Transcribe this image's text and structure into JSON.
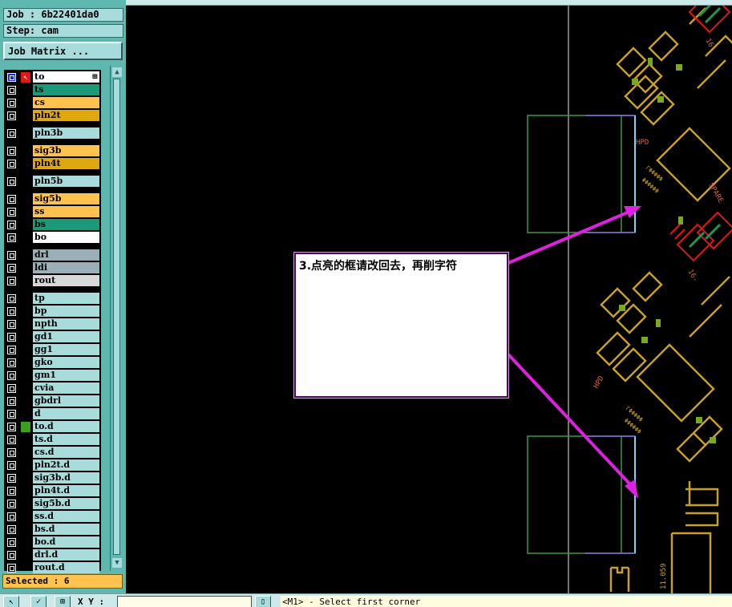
{
  "job": {
    "label": "Job : 6b22401da0"
  },
  "step": {
    "label": "Step: cam"
  },
  "job_matrix_button": "Job Matrix ...",
  "layers": [
    {
      "name": "to",
      "color": "#ffffff",
      "active": true
    },
    {
      "name": "ts",
      "color": "#1a9a78"
    },
    {
      "name": "cs",
      "color": "#ffc24d"
    },
    {
      "name": "pln2t",
      "color": "#e0a810"
    },
    {
      "name": "pln3b",
      "color": "#a8dcdc"
    },
    {
      "name": "sig3b",
      "color": "#ffc24d"
    },
    {
      "name": "pln4t",
      "color": "#e0a810"
    },
    {
      "name": "pln5b",
      "color": "#a8dcdc"
    },
    {
      "name": "sig5b",
      "color": "#ffc24d"
    },
    {
      "name": "ss",
      "color": "#ffc24d"
    },
    {
      "name": "bs",
      "color": "#1a9a78"
    },
    {
      "name": "bo",
      "color": "#ffffff"
    },
    {
      "name": "drl",
      "color": "#9ab0b8"
    },
    {
      "name": "ldi",
      "color": "#9ab0b8"
    },
    {
      "name": "rout",
      "color": "#d8d8d8"
    },
    {
      "name": "tp",
      "color": "#a8dcdc"
    },
    {
      "name": "bp",
      "color": "#a8dcdc"
    },
    {
      "name": "npth",
      "color": "#a8dcdc"
    },
    {
      "name": "gd1",
      "color": "#a8dcdc"
    },
    {
      "name": "gg1",
      "color": "#a8dcdc"
    },
    {
      "name": "gko",
      "color": "#a8dcdc"
    },
    {
      "name": "gm1",
      "color": "#a8dcdc"
    },
    {
      "name": "cvia",
      "color": "#a8dcdc"
    },
    {
      "name": "gbdrl",
      "color": "#a8dcdc"
    },
    {
      "name": "d",
      "color": "#a8dcdc"
    },
    {
      "name": "to.d",
      "color": "#a8dcdc",
      "marked": true
    },
    {
      "name": "ts.d",
      "color": "#a8dcdc"
    },
    {
      "name": "cs.d",
      "color": "#a8dcdc"
    },
    {
      "name": "pln2t.d",
      "color": "#a8dcdc"
    },
    {
      "name": "sig3b.d",
      "color": "#a8dcdc"
    },
    {
      "name": "pln4t.d",
      "color": "#a8dcdc"
    },
    {
      "name": "sig5b.d",
      "color": "#a8dcdc"
    },
    {
      "name": "ss.d",
      "color": "#a8dcdc"
    },
    {
      "name": "bs.d",
      "color": "#a8dcdc"
    },
    {
      "name": "bo.d",
      "color": "#a8dcdc"
    },
    {
      "name": "drl.d",
      "color": "#a8dcdc"
    },
    {
      "name": "rout.d",
      "color": "#a8dcdc"
    }
  ],
  "selected": {
    "label": "Selected : 6"
  },
  "annotation": {
    "text": "3.点亮的框请改回去，再削字符"
  },
  "pcb_labels": {
    "label_top": "16-",
    "label_hpd": "HPD",
    "label_spare": "SPARE",
    "label_16": "16-",
    "label_hpd_lower": "HPD",
    "label_dim": "11.059"
  },
  "bottom_bar": {
    "xy_label": "X Y :",
    "status": "<M1> - Select first corner"
  },
  "colors": {
    "panel": "#5fb8b0",
    "canvas": "#000000",
    "pcb_trace": "#c8a028",
    "selection": "#e020e0"
  }
}
